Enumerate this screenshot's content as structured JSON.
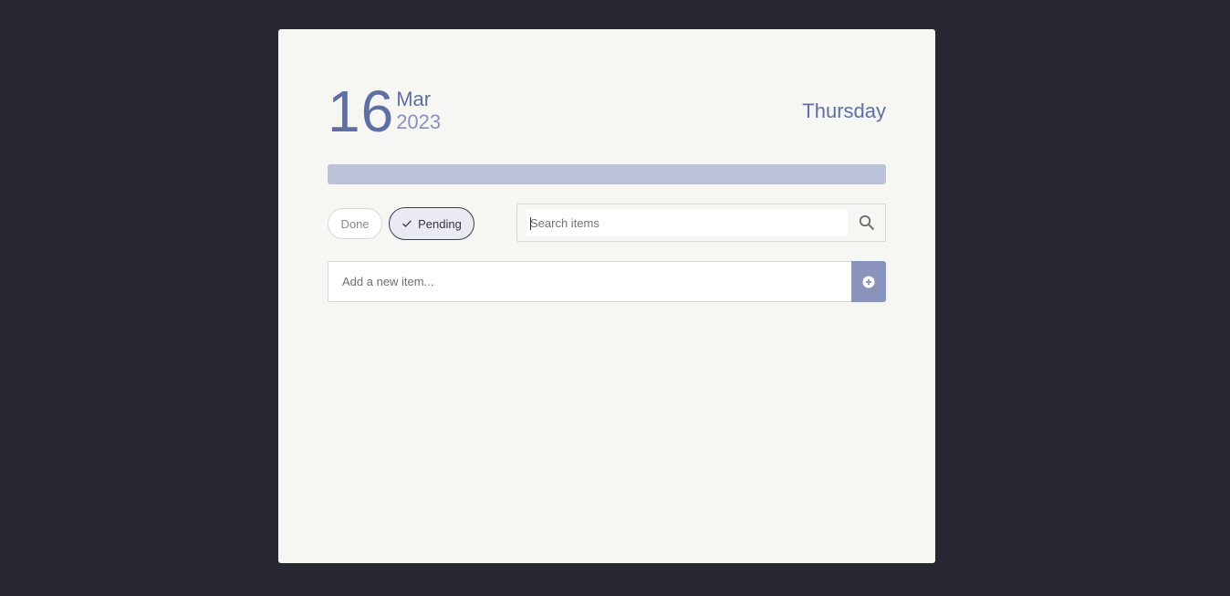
{
  "date": {
    "day": "16",
    "month": "Mar",
    "year": "2023",
    "weekday": "Thursday"
  },
  "progress": {
    "fraction": 1.0
  },
  "filters": {
    "done_label": "Done",
    "pending_label": "Pending",
    "active": "Pending"
  },
  "search": {
    "placeholder": "Search items",
    "icon": "search-icon"
  },
  "add_item": {
    "placeholder": "Add a new item...",
    "icon": "plus-circle-icon"
  },
  "colors": {
    "background": "#272833",
    "card": "#f6f7f2",
    "accent": "#5f6fa4",
    "progress": "#bcc2d8",
    "add_button": "#8a93bb"
  }
}
